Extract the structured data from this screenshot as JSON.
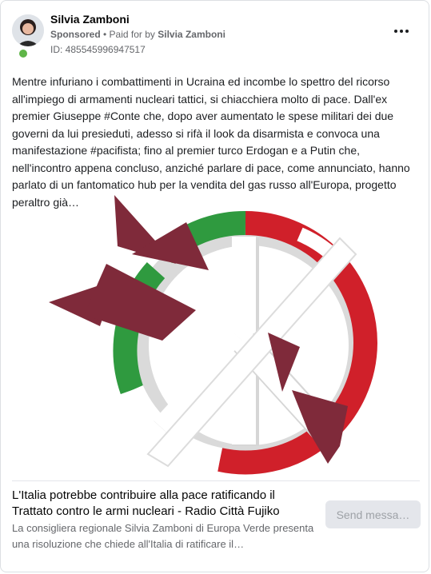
{
  "post": {
    "author": "Silvia Zamboni",
    "sponsored_label": "Sponsored",
    "separator": " • ",
    "paid_prefix": "Paid for by ",
    "paid_by": "Silvia Zamboni",
    "ad_id": "ID: 485545996947517",
    "body": "Mentre infuriano i combattimenti in Ucraina ed incombe lo spettro del ricorso all'impiego di armamenti nucleari tattici, si chiacchiera molto di pace. Dall'ex premier Giuseppe #Conte che, dopo aver aumentato le spese militari dei due governi da lui presieduti, adesso si rifà il look da disarmista e convoca una manifestazione #pacifista; fino al premier turco Erdogan e a Putin che, nell'incontro appena concluso, anziché parlare di pace, come annunciato, hanno parlato di un fantomatico hub per la vendita del gas russo all'Europa, progetto peraltro già…"
  },
  "image": {
    "icon": "peace-symbol-with-bombs-icon",
    "colors": {
      "bomb": "#7f2a3a",
      "green": "#2f9a3f",
      "red": "#d0202a",
      "white": "#ffffff",
      "shadow": "#d8d8d8"
    }
  },
  "link": {
    "title": "L'Italia potrebbe contribuire alla pace ratificando il Trattato contro le armi nucleari - Radio Città Fujiko",
    "description": "La consigliera regionale Silvia Zamboni di Europa Verde presenta una risoluzione che chiede all'Italia di ratificare il…",
    "button_label": "Send messa…"
  },
  "icons": {
    "more": "more-options-icon",
    "avatar": "avatar"
  }
}
